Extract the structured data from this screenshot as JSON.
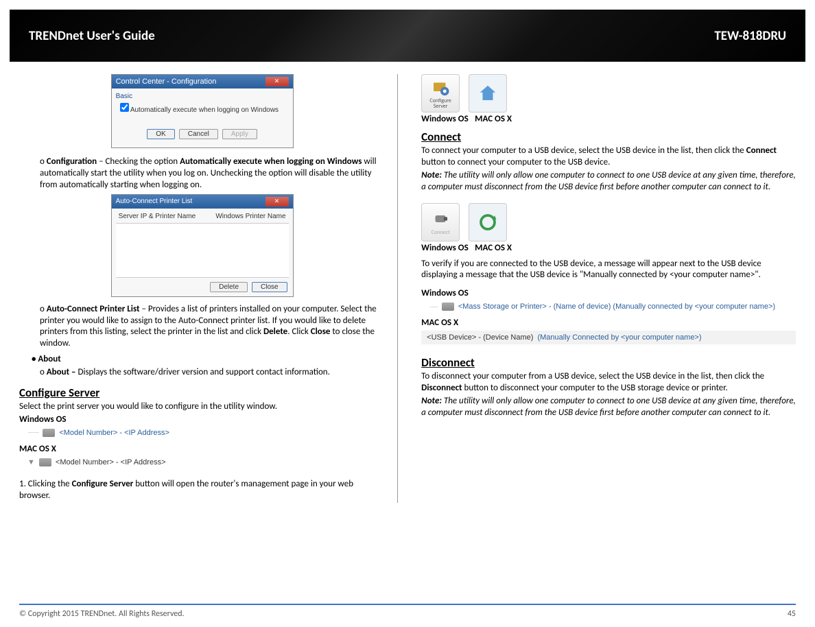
{
  "header": {
    "title": "TRENDnet User's Guide",
    "model": "TEW-818DRU"
  },
  "left": {
    "dialog_config": {
      "title": "Control Center - Configuration",
      "fieldset": "Basic",
      "checkbox_label": "Automatically execute when logging on Windows",
      "btn_ok": "OK",
      "btn_cancel": "Cancel",
      "btn_apply": "Apply"
    },
    "config_para_prefix": "o ",
    "config_para_bold1": "Configuration",
    "config_para_mid": " – Checking the option ",
    "config_para_bold2": "Automatically execute when logging on Windows",
    "config_para_end": " will automatically start the utility when you log on. Unchecking the option will disable the utility from automatically starting when logging on.",
    "dialog_printer": {
      "title": "Auto-Connect Printer List",
      "col1": "Server IP & Printer Name",
      "col2": "Windows Printer Name",
      "btn_delete": "Delete",
      "btn_close": "Close"
    },
    "autoconnect_prefix": "o ",
    "autoconnect_bold": "Auto-Connect Printer List",
    "autoconnect_text": " – Provides a list of printers installed on your computer. Select the printer you would like to assign to the Auto-Connect printer list. If you would like to delete printers from this listing, select the printer in the list and click ",
    "autoconnect_delete": "Delete",
    "autoconnect_mid": ". Click ",
    "autoconnect_close": "Close",
    "autoconnect_end": " to close the window.",
    "about_bold": "About",
    "about_sub_prefix": "o ",
    "about_sub_bold": "About –",
    "about_sub_text": " Displays the software/driver version and support contact information.",
    "configure_heading": "Configure Server",
    "configure_text": "Select the print server you would like to configure in the utility window.",
    "windows_os": "Windows OS",
    "mac_os": "MAC OS X",
    "model_ip": "<Model Number> - <IP Address>",
    "step1_prefix": "1. Clicking the ",
    "step1_bold": "Configure Server",
    "step1_end": " button will open the router's management page in your web browser."
  },
  "right": {
    "icon_config_label": "Configure Server",
    "windows_os": "Windows OS",
    "mac_os": "MAC OS X",
    "connect_heading": "Connect",
    "connect_text1": "To connect your computer to a USB device, select the USB device in the list, then click the ",
    "connect_bold": "Connect",
    "connect_text2": " button to connect your computer to the USB device.",
    "note_bold": "Note:",
    "note_text": " The utility will only allow one computer to connect to one USB device at any given time, therefore, a computer must disconnect from the USB device first before another computer can connect to it.",
    "icon_connect_label": "Connect",
    "verify_text": "To verify if you are connected to the USB device, a message will appear next to the USB device displaying a message that the USB device is \"Manually connected by <your computer name>\".",
    "win_msg": "<Mass Storage or Printer> - (Name of device)  (Manually connected by <your computer name>)",
    "mac_msg_1": "<USB Device> - (Device Name)",
    "mac_msg_2": "(Manually Connected by <your computer name>)",
    "disconnect_heading": "Disconnect",
    "disconnect_text1": "To disconnect your computer from a USB device, select the USB device in the list, then click the ",
    "disconnect_bold": "Disconnect",
    "disconnect_text2": " button to disconnect your computer to the USB storage device or printer.",
    "disconnect_note": " The utility will only allow one computer to connect to one USB device at any given time, therefore, a computer must disconnect from the USB device first before another computer can connect to it."
  },
  "footer": {
    "copyright": "© Copyright 2015 TRENDnet. All Rights Reserved.",
    "page": "45"
  }
}
